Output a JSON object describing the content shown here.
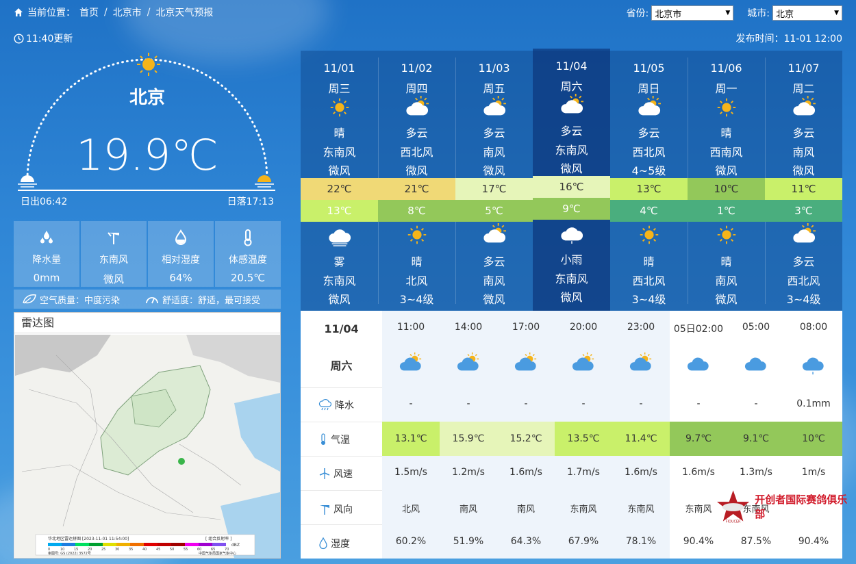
{
  "breadcrumb": {
    "prefix": "当前位置：",
    "home": "首页",
    "province": "北京市",
    "page": "北京天气预报",
    "sep": "/"
  },
  "selectors": {
    "province_label": "省份:",
    "province_value": "北京市",
    "city_label": "城市:",
    "city_value": "北京"
  },
  "update_time": "11:40更新",
  "publish_time": "发布时间：11-01 12:00",
  "current": {
    "city": "北京",
    "temp": "19.9℃",
    "sunrise": "日出06:42",
    "sunset": "日落17:13"
  },
  "stats": [
    {
      "icon": "raindrops-icon",
      "label": "降水量",
      "value": "0mm"
    },
    {
      "icon": "wind-vane-icon",
      "label": "东南风",
      "value": "微风"
    },
    {
      "icon": "humidity-drop-icon",
      "label": "相对湿度",
      "value": "64%"
    },
    {
      "icon": "thermometer-icon",
      "label": "体感温度",
      "value": "20.5℃"
    }
  ],
  "air_quality": "空气质量：中度污染",
  "comfort": "舒适度：舒适，最可接受",
  "radar": {
    "title": "雷达图",
    "caption": "华北地区雷达拼图 [2023-11-01 11:54:00]",
    "caption_right": "[ 组合反射率 ]",
    "scale": [
      "0",
      "10",
      "15",
      "20",
      "25",
      "30",
      "35",
      "40",
      "45",
      "50",
      "55",
      "60",
      "65",
      "70"
    ],
    "unit": "dBZ",
    "footer_left": "审图号: GS (2022) 3572号",
    "footer_right": "中国气象局国家气象中心"
  },
  "days": [
    {
      "date": "11/01",
      "week": "周三",
      "day_icon": "sun",
      "day_wx": "晴",
      "day_wd": "东南风",
      "day_wp": "微风",
      "hi": "22℃",
      "hi_color": "#f0d976",
      "lo": "13℃",
      "lo_color": "#c9f06a",
      "n_icon": "fog",
      "n_wx": "雾",
      "n_wd": "东南风",
      "n_wp": "微风"
    },
    {
      "date": "11/02",
      "week": "周四",
      "day_icon": "partly",
      "day_wx": "多云",
      "day_wd": "西北风",
      "day_wp": "微风",
      "hi": "21℃",
      "hi_color": "#f0d976",
      "lo": "8℃",
      "lo_color": "#93c85a",
      "n_icon": "sun",
      "n_wx": "晴",
      "n_wd": "北风",
      "n_wp": "3~4级"
    },
    {
      "date": "11/03",
      "week": "周五",
      "day_icon": "partly",
      "day_wx": "多云",
      "day_wd": "南风",
      "day_wp": "微风",
      "hi": "17℃",
      "hi_color": "#e6f5b9",
      "lo": "5℃",
      "lo_color": "#93c85a",
      "n_icon": "partly",
      "n_wx": "多云",
      "n_wd": "南风",
      "n_wp": "微风"
    },
    {
      "date": "11/04",
      "week": "周六",
      "day_icon": "partly",
      "day_wx": "多云",
      "day_wd": "东南风",
      "day_wp": "微风",
      "hi": "16℃",
      "hi_color": "#e6f5b9",
      "lo": "9℃",
      "lo_color": "#93c85a",
      "n_icon": "rain",
      "n_wx": "小雨",
      "n_wd": "东南风",
      "n_wp": "微风"
    },
    {
      "date": "11/05",
      "week": "周日",
      "day_icon": "partly",
      "day_wx": "多云",
      "day_wd": "西北风",
      "day_wp": "4~5级",
      "hi": "13℃",
      "hi_color": "#c9f06a",
      "lo": "4℃",
      "lo_color": "#4aae7e",
      "n_icon": "sun",
      "n_wx": "晴",
      "n_wd": "西北风",
      "n_wp": "3~4级"
    },
    {
      "date": "11/06",
      "week": "周一",
      "day_icon": "sun",
      "day_wx": "晴",
      "day_wd": "西南风",
      "day_wp": "微风",
      "hi": "10℃",
      "hi_color": "#93c85a",
      "lo": "1℃",
      "lo_color": "#4aae7e",
      "n_icon": "sun",
      "n_wx": "晴",
      "n_wd": "南风",
      "n_wp": "微风"
    },
    {
      "date": "11/07",
      "week": "周二",
      "day_icon": "partly",
      "day_wx": "多云",
      "day_wd": "南风",
      "day_wp": "微风",
      "hi": "11℃",
      "hi_color": "#c9f06a",
      "lo": "3℃",
      "lo_color": "#4aae7e",
      "n_icon": "partly",
      "n_wx": "多云",
      "n_wd": "西北风",
      "n_wp": "3~4级"
    }
  ],
  "active_day": 3,
  "hourly": {
    "date": "11/04",
    "week": "周六",
    "labels": {
      "rain": "降水",
      "temp": "气温",
      "ws": "风速",
      "wd": "风向",
      "hum": "湿度"
    },
    "hours": [
      {
        "time": "11:00",
        "icon": "partly",
        "rain": "-",
        "temp": "13.1℃",
        "temp_color": "#c9f06a",
        "ws": "1.5m/s",
        "wd": "北风",
        "hum": "60.2%"
      },
      {
        "time": "14:00",
        "icon": "partly",
        "rain": "-",
        "temp": "15.9℃",
        "temp_color": "#e6f5b9",
        "ws": "1.2m/s",
        "wd": "南风",
        "hum": "51.9%"
      },
      {
        "time": "17:00",
        "icon": "partly",
        "rain": "-",
        "temp": "15.2℃",
        "temp_color": "#e6f5b9",
        "ws": "1.6m/s",
        "wd": "南风",
        "hum": "64.3%"
      },
      {
        "time": "20:00",
        "icon": "partly",
        "rain": "-",
        "temp": "13.5℃",
        "temp_color": "#c9f06a",
        "ws": "1.7m/s",
        "wd": "东南风",
        "hum": "67.9%"
      },
      {
        "time": "23:00",
        "icon": "partly",
        "rain": "-",
        "temp": "11.4℃",
        "temp_color": "#c9f06a",
        "ws": "1.6m/s",
        "wd": "东南风",
        "hum": "78.1%"
      },
      {
        "time": "05日02:00",
        "icon": "cloud",
        "rain": "-",
        "temp": "9.7℃",
        "temp_color": "#93c85a",
        "ws": "1.6m/s",
        "wd": "东南风",
        "hum": "90.4%"
      },
      {
        "time": "05:00",
        "icon": "cloud",
        "rain": "-",
        "temp": "9.1℃",
        "temp_color": "#93c85a",
        "ws": "1.3m/s",
        "wd": "东南风",
        "hum": "87.5%"
      },
      {
        "time": "08:00",
        "icon": "rain",
        "rain": "0.1mm",
        "temp": "10℃",
        "temp_color": "#93c85a",
        "ws": "1m/s",
        "wd": "",
        "hum": "90.4%"
      }
    ]
  },
  "watermark": {
    "badge": "FIOUCER",
    "text": "开创者国际赛鸽俱乐部"
  }
}
